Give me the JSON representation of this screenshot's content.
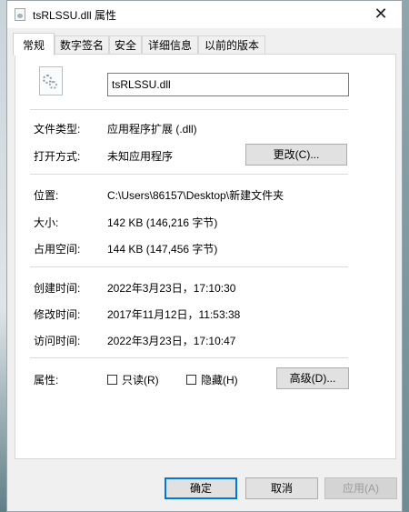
{
  "window": {
    "title": "tsRLSSU.dll 属性",
    "close_glyph": "✕"
  },
  "tabs": [
    "常规",
    "数字签名",
    "安全",
    "详细信息",
    "以前的版本"
  ],
  "general": {
    "filename": "tsRLSSU.dll",
    "type_label": "文件类型:",
    "type_value": "应用程序扩展 (.dll)",
    "opens_label": "打开方式:",
    "opens_value": "未知应用程序",
    "change_button": "更改(C)...",
    "location_label": "位置:",
    "location_value": "C:\\Users\\86157\\Desktop\\新建文件夹",
    "size_label": "大小:",
    "size_value": "142 KB (146,216 字节)",
    "disk_label": "占用空间:",
    "disk_value": "144 KB (147,456 字节)",
    "created_label": "创建时间:",
    "created_value": "2022年3月23日，17:10:30",
    "modified_label": "修改时间:",
    "modified_value": "2017年11月12日，11:53:38",
    "accessed_label": "访问时间:",
    "accessed_value": "2022年3月23日，17:10:47",
    "attributes_label": "属性:",
    "readonly_label": "只读(R)",
    "hidden_label": "隐藏(H)",
    "advanced_button": "高级(D)..."
  },
  "footer": {
    "ok": "确定",
    "cancel": "取消",
    "apply": "应用(A)"
  }
}
